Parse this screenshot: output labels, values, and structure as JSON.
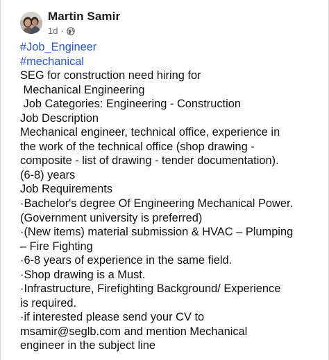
{
  "post": {
    "author": "Martin Samir",
    "time": "1d",
    "separator": "·",
    "privacy_icon": "globe-icon",
    "hashtags": [
      "#Job_Engineer",
      "#mechanical"
    ],
    "lines": [
      "SEG for construction need hiring for",
      " Mechanical Engineering",
      " Job Categories: Engineering - Construction",
      "Job Description",
      "Mechanical engineer, technical office, experience in",
      "the work of the technical office (shop drawing -",
      "composite - list of drawing - tender documentation).",
      "(6-8) years",
      "Job Requirements",
      "·Bachelor's degree Of Engineering Mechanical Power.",
      "(Government university is preferred)",
      "·(New items) material submission & HVAC – Plumping",
      "– Fire Fighting",
      "·6-8 years of experience in the same field.",
      "·Shop drawing is a Must.",
      "·Infrastructure, Firefighting Background/ Experience",
      "is required.",
      "·if interested please send your CV to",
      "msamir@seglb.com and mention Mechanical",
      "engineer in the subject line"
    ]
  },
  "colors": {
    "hashtag": "#2a55c7",
    "text": "#111111",
    "secondary": "#65676b"
  }
}
